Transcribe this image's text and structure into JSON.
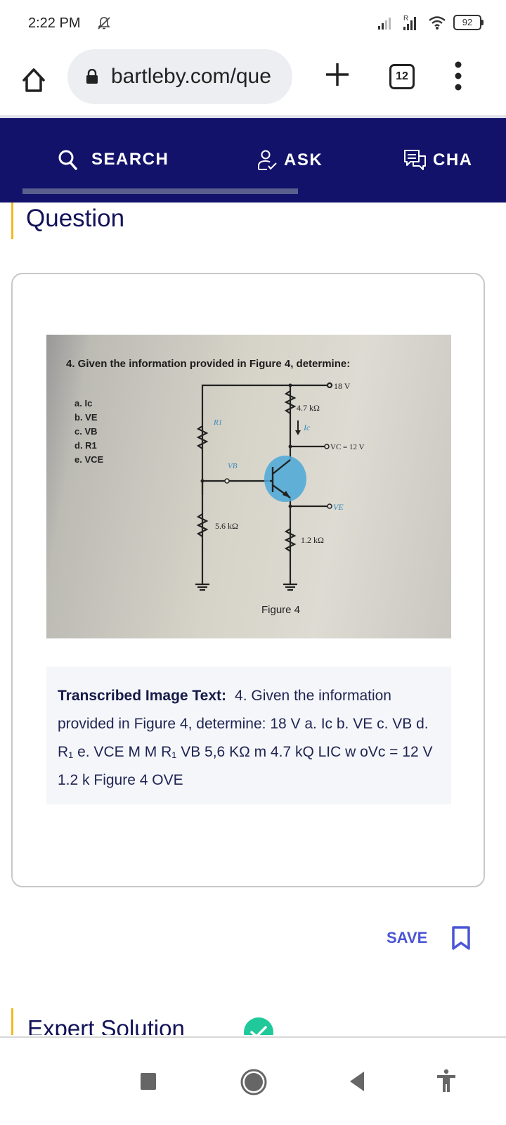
{
  "status_bar": {
    "time": "2:22 PM",
    "icons": [
      "silent-bell-icon",
      "signal-icon",
      "roaming-signal-icon",
      "wifi-icon"
    ],
    "battery_level": "92"
  },
  "browser": {
    "url": "bartleby.com/que",
    "tab_count": "12",
    "buttons": [
      "home",
      "new-tab",
      "tab-switcher",
      "menu"
    ]
  },
  "site_nav": {
    "items": [
      {
        "label": "SEARCH",
        "icon": "search-icon"
      },
      {
        "label": "ASK",
        "icon": "person-check-icon"
      },
      {
        "label": "CHA",
        "icon": "chat-icon"
      }
    ],
    "active_index": 0
  },
  "question": {
    "heading": "Question",
    "figure": {
      "prompt": "4. Given the information provided in Figure 4, determine:",
      "items": [
        "a. Ic",
        "b. VE",
        "c. VB",
        "d. R1",
        "e. VCE"
      ],
      "labels": {
        "supply": "18 V",
        "rc": "4.7 kΩ",
        "r1": "R1",
        "ic": "Ic",
        "vc": "VC = 12 V",
        "vb": "VB",
        "ve": "VE",
        "r2": "5.6 kΩ",
        "re": "1.2 kΩ",
        "caption": "Figure 4"
      }
    },
    "transcribed_label": "Transcribed Image Text:",
    "transcribed_text": "4. Given the information provided in Figure 4, determine: 18 V a. Ic b. VE c. VB d. R₁ e. VCE M M R₁ VB 5,6 KΩ m 4.7 kQ LIC w oVc = 12 V 1.2 k Figure 4 OVE"
  },
  "save": {
    "label": "SAVE"
  },
  "expert_solution": {
    "heading": "Expert Solution"
  },
  "colors": {
    "nav_bg": "#12126a",
    "accent_yellow": "#f2b824",
    "save_blue": "#4a55d6",
    "check_green": "#1fc99a",
    "transistor_blue": "#4aa8d8"
  }
}
